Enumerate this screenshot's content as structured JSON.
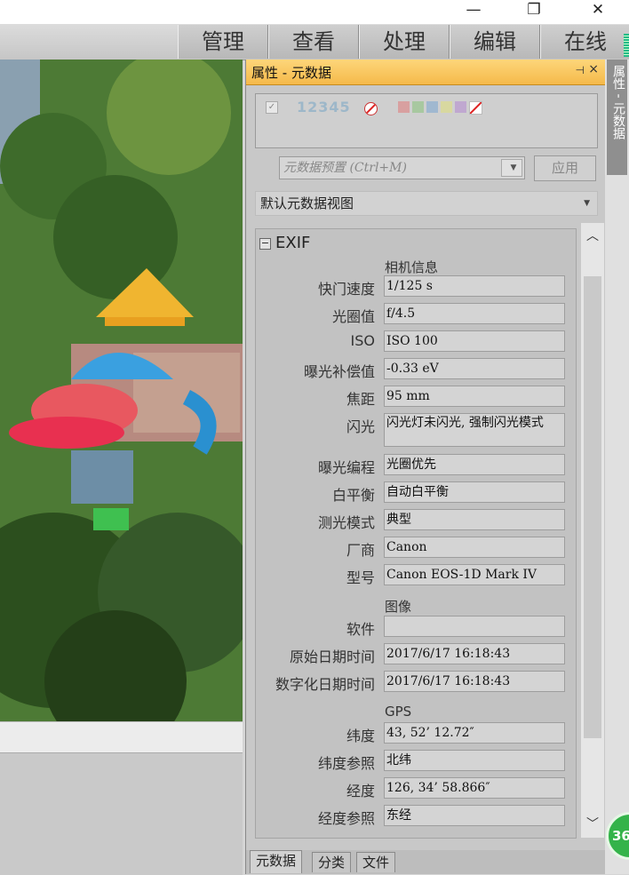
{
  "window": {
    "minimize_glyph": "—",
    "restore_glyph": "❐",
    "close_glyph": "✕"
  },
  "modes": [
    "管理",
    "查看",
    "处理",
    "编辑",
    "在线"
  ],
  "panel": {
    "title": "属性 - 元数据",
    "pin_glyph": "⊣",
    "close_glyph": "×",
    "rating_digits": "12345",
    "swatches": [
      "#d8a0a0",
      "#a8c8a0",
      "#a0b8d0",
      "#d8d8a0",
      "#c0a8d0"
    ],
    "preset_placeholder": "元数据预置 (Ctrl+M)",
    "apply_label": "应用",
    "view_selector": "默认元数据视图",
    "exif_header": "EXIF",
    "section_camera": "相机信息",
    "section_image": "图像",
    "section_gps": "GPS",
    "fields": [
      {
        "label": "快门速度",
        "value": "1/125 s"
      },
      {
        "label": "光圈值",
        "value": "f/4.5"
      },
      {
        "label": "ISO",
        "value": "ISO 100"
      },
      {
        "label": "曝光补偿值",
        "value": "-0.33 eV"
      },
      {
        "label": "焦距",
        "value": "95 mm"
      },
      {
        "label": "闪光",
        "value": "闪光灯未闪光, 强制闪光模式"
      },
      {
        "label": "曝光编程",
        "value": "光圈优先"
      },
      {
        "label": "白平衡",
        "value": "自动白平衡"
      },
      {
        "label": "测光模式",
        "value": "典型"
      },
      {
        "label": "厂商",
        "value": "Canon"
      },
      {
        "label": "型号",
        "value": "Canon EOS-1D Mark IV"
      },
      {
        "label": "软件",
        "value": ""
      },
      {
        "label": "原始日期时间",
        "value": "2017/6/17 16:18:43"
      },
      {
        "label": "数字化日期时间",
        "value": "2017/6/17 16:18:43"
      },
      {
        "label": "纬度",
        "value": "43, 52’ 12.72″"
      },
      {
        "label": "纬度参照",
        "value": "北纬"
      },
      {
        "label": "经度",
        "value": "126, 34’ 58.866″"
      },
      {
        "label": "经度参照",
        "value": "东经"
      }
    ],
    "tabs": [
      "元数据",
      "分类",
      "文件"
    ]
  },
  "sidebar_tab": "属性 - 元数据",
  "badge": "36"
}
